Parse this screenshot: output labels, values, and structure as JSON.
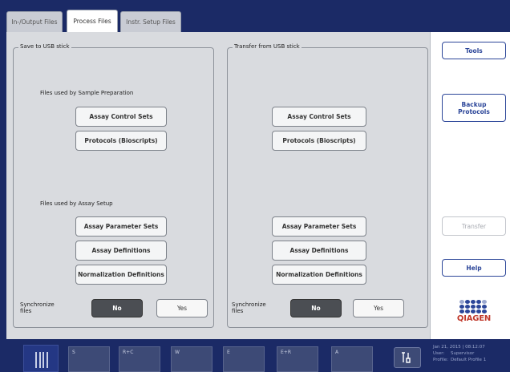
{
  "tabs": [
    {
      "label": "In-/Output Files",
      "active": false
    },
    {
      "label": "Process Files",
      "active": true
    },
    {
      "label": "Instr. Setup Files",
      "active": false
    }
  ],
  "save_group": {
    "title": "Save to USB stick",
    "sample_prep_label": "Files used by Sample Preparation",
    "assay_setup_label": "Files used by Assay Setup",
    "buttons": [
      "Assay Control Sets",
      "Protocols (Bioscripts)",
      "Assay Parameter Sets",
      "Assay Definitions",
      "Normalization Definitions"
    ],
    "sync_label": "Synchronize files",
    "no_label": "No",
    "yes_label": "Yes",
    "sync_selected": "No"
  },
  "transfer_group": {
    "title": "Transfer from USB stick",
    "buttons": [
      "Assay Control Sets",
      "Protocols (Bioscripts)",
      "Assay Parameter Sets",
      "Assay Definitions",
      "Normalization Definitions"
    ],
    "sync_label": "Synchronize files",
    "no_label": "No",
    "yes_label": "Yes",
    "sync_selected": "No"
  },
  "sidebar": {
    "tools_label": "Tools",
    "backup_label": "Backup Protocols",
    "transfer_label": "Transfer",
    "transfer_enabled": false,
    "help_label": "Help",
    "logo_text": "QIAGEN"
  },
  "bottom": {
    "drawers": [
      "S",
      "R+C",
      "W",
      "E",
      "E+R",
      "A"
    ],
    "tools_icon": "wrench-screwdriver-icon",
    "date": "Jan 21, 2015 | 08:12:07",
    "user_label": "User:",
    "user_value": "Supervisor",
    "profile_label": "Profile:",
    "profile_value": "Default Profile 1"
  },
  "colors": {
    "navy": "#1b2a66",
    "accent_blue": "#2c4699",
    "qiagen_red": "#c0392b",
    "selected_dark": "#4b4e53"
  }
}
